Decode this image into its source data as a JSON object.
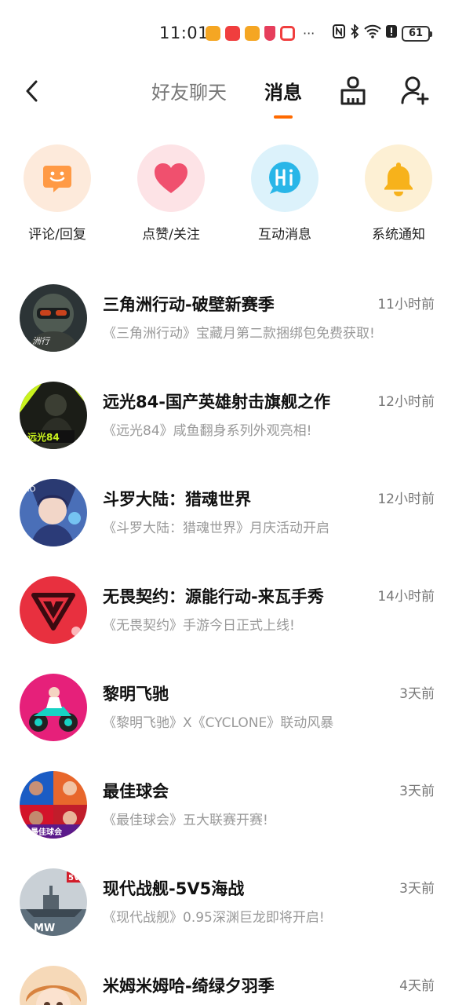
{
  "status_bar": {
    "time": "11:01",
    "dots": "···",
    "battery": "61",
    "icons": [
      "app-notification-icon",
      "video-app-icon",
      "app-notification-icon",
      "shield-app-icon",
      "red-app-icon",
      "nfc-icon",
      "bluetooth-icon",
      "wifi-icon",
      "alert-icon",
      "battery-icon"
    ]
  },
  "header": {
    "tabs": [
      {
        "label": "好友聊天",
        "active": false
      },
      {
        "label": "消息",
        "active": true
      }
    ],
    "accent_color": "#ff6a00"
  },
  "categories": [
    {
      "label": "评论/回复",
      "icon": "chat-smile-icon",
      "bg": "#fdeadb",
      "color": "#ff9a45"
    },
    {
      "label": "点赞/关注",
      "icon": "heart-icon",
      "bg": "#fde3e6",
      "color": "#f0506e"
    },
    {
      "label": "互动消息",
      "icon": "hi-bubble-icon",
      "bg": "#dcf2fb",
      "color": "#29b6e8"
    },
    {
      "label": "系统通知",
      "icon": "bell-icon",
      "bg": "#fdf0d4",
      "color": "#f7b21b"
    }
  ],
  "messages": [
    {
      "title": "三角洲行动-破壁新赛季",
      "time": "11小时前",
      "preview": "《三角洲行动》宝藏月第二款捆绑包免费获取!",
      "avatar": "game-avatar-delta-force"
    },
    {
      "title": "远光84-国产英雄射击旗舰之作",
      "time": "12小时前",
      "preview": "《远光84》咸鱼翻身系列外观亮相!",
      "avatar": "game-avatar-farlight84"
    },
    {
      "title": "斗罗大陆：猎魂世界",
      "time": "12小时前",
      "preview": "《斗罗大陆：猎魂世界》月庆活动开启",
      "avatar": "game-avatar-douluo"
    },
    {
      "title": "无畏契约：源能行动-来瓦手秀",
      "time": "14小时前",
      "preview": "《无畏契约》手游今日正式上线!",
      "avatar": "game-avatar-valorant"
    },
    {
      "title": "黎明飞驰",
      "time": "3天前",
      "preview": "《黎明飞驰》X《CYCLONE》联动风暴",
      "avatar": "game-avatar-dawn-racing"
    },
    {
      "title": "最佳球会",
      "time": "3天前",
      "preview": "《最佳球会》五大联赛开赛!",
      "avatar": "game-avatar-best-club"
    },
    {
      "title": "现代战舰-5V5海战",
      "time": "3天前",
      "preview": "《现代战舰》0.95深渊巨龙即将开启!",
      "avatar": "game-avatar-modern-warships"
    },
    {
      "title": "米姆米姆哈-绮绿夕羽季",
      "time": "4天前",
      "preview": "",
      "avatar": "game-avatar-mimumimuha"
    }
  ]
}
